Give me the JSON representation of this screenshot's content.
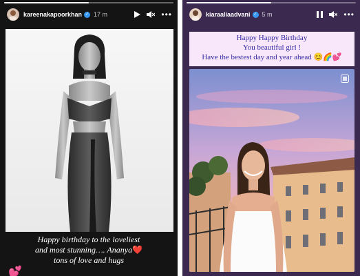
{
  "story_left": {
    "username": "kareenakapoorkhan",
    "time": "17 m",
    "icons": [
      "play-icon",
      "mute-icon",
      "more-icon"
    ],
    "progress": 0.5,
    "caption_lines": [
      "Happy birthday to the loveliest",
      "and most stunning…. Ananya",
      "tons of love and hugs"
    ],
    "caption_emoji": "❤️",
    "sticker": "💕"
  },
  "story_right": {
    "username": "kiaraaliaadvani",
    "time": "5 m",
    "icons": [
      "pause-icon",
      "mute-icon",
      "more-icon"
    ],
    "progress": 0.5,
    "banner_lines": [
      "Happy Happy Birthday",
      "You beautiful girl !",
      "Have the bestest day and year ahead 😊🌈💕"
    ]
  },
  "colors": {
    "left_bg": "#141414",
    "right_bg": "#3b2950",
    "banner_bg": "#f8e7fb",
    "banner_text": "#342aa0",
    "verified": "#3897f0"
  }
}
